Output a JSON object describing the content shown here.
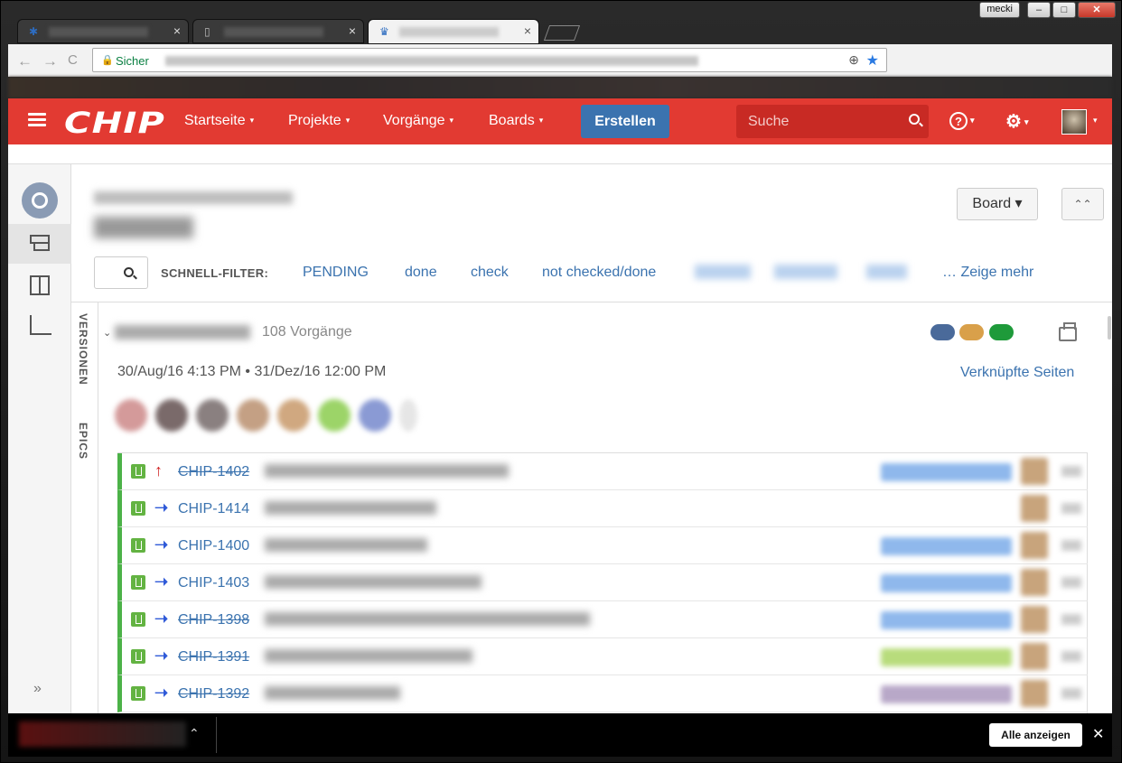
{
  "window": {
    "user": "mecki",
    "minimize": "–",
    "maximize": "□",
    "close": "✕"
  },
  "browser": {
    "tabs": [
      {
        "close": "×"
      },
      {
        "close": "×"
      },
      {
        "close": "×"
      }
    ],
    "back": "←",
    "forward": "→",
    "reload": "C",
    "secure_label": "Sicher",
    "lock": "🔒",
    "zoom": "⊕",
    "star": "★"
  },
  "header": {
    "logo": "CHIP",
    "menu": [
      "Startseite",
      "Projekte",
      "Vorgänge",
      "Boards"
    ],
    "create": "Erstellen",
    "search_placeholder": "Suche",
    "help": "?",
    "settings": "⚙",
    "caret": "▾"
  },
  "board": {
    "board_button": "Board ▾",
    "collapse": "⌃⌃",
    "filter_label": "SCHNELL-FILTER:",
    "filters": [
      "PENDING",
      "done",
      "check",
      "not checked/done"
    ],
    "more": "… Zeige mehr",
    "side_tabs": [
      "VERSIONEN",
      "EPICS"
    ],
    "expand": "»"
  },
  "sprint": {
    "chevron": "⌄",
    "count": "108 Vorgänge",
    "dates": "30/Aug/16 4:13 PM  •  31/Dez/16 12:00 PM",
    "linked_pages": "Verknüpfte Seiten",
    "pill_colors": [
      "#4a6a9a",
      "#d9a04a",
      "#1e9a3a"
    ]
  },
  "issues": [
    {
      "key": "CHIP-1402",
      "done": true,
      "priority": "↑",
      "priority_color": "#d02020",
      "epic_color": "#8fb8ec"
    },
    {
      "key": "CHIP-1414",
      "done": false,
      "priority": "➝",
      "priority_color": "#2f5ad8",
      "epic_color": ""
    },
    {
      "key": "CHIP-1400",
      "done": false,
      "priority": "➝",
      "priority_color": "#2f5ad8",
      "epic_color": "#8fb8ec"
    },
    {
      "key": "CHIP-1403",
      "done": false,
      "priority": "➝",
      "priority_color": "#2f5ad8",
      "epic_color": "#8fb8ec"
    },
    {
      "key": "CHIP-1398",
      "done": true,
      "priority": "➝",
      "priority_color": "#2f5ad8",
      "epic_color": "#8fb8ec"
    },
    {
      "key": "CHIP-1391",
      "done": true,
      "priority": "➝",
      "priority_color": "#2f5ad8",
      "epic_color": "#b8dc7c"
    },
    {
      "key": "CHIP-1392",
      "done": true,
      "priority": "➝",
      "priority_color": "#2f5ad8",
      "epic_color": "#b8a8c8"
    }
  ],
  "downloads": {
    "chevron": "⌃",
    "show_all": "Alle anzeigen",
    "close": "✕"
  }
}
